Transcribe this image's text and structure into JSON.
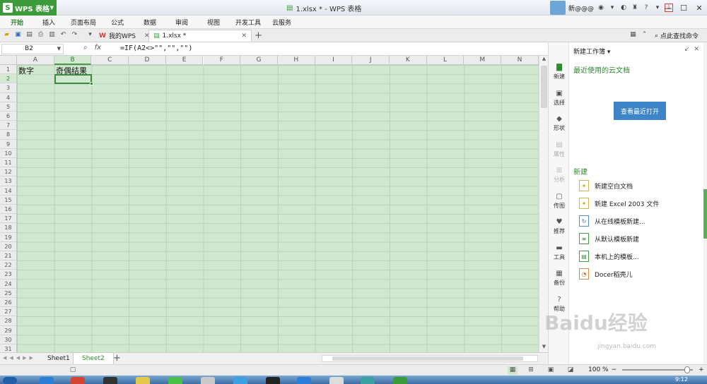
{
  "app": {
    "brand": "WPS 表格",
    "logo_letter": "S",
    "doc_title": "1.xlsx * - WPS 表格",
    "user_name": "新@@@"
  },
  "menu": [
    "开始",
    "插入",
    "页面布局",
    "公式",
    "数据",
    "审阅",
    "视图",
    "开发工具",
    "云服务"
  ],
  "tabs": [
    {
      "label": "我的WPS"
    },
    {
      "label": "1.xlsx *"
    }
  ],
  "command_search": "点此查找命令",
  "formula_bar": {
    "name_box": "B2",
    "formula": "=IF(A2<>\"\",\"\",\"\")",
    "fx_label": "fx"
  },
  "grid": {
    "columns": [
      "A",
      "B",
      "C",
      "D",
      "E",
      "F",
      "G",
      "H",
      "I",
      "J",
      "K",
      "L",
      "M",
      "N"
    ],
    "rows": [
      "1",
      "2",
      "3",
      "4",
      "5",
      "6",
      "7",
      "8",
      "9",
      "10",
      "11",
      "12",
      "13",
      "14",
      "15",
      "16",
      "17",
      "18",
      "19",
      "20",
      "21",
      "22",
      "23",
      "24",
      "25",
      "26",
      "27",
      "28",
      "29",
      "30",
      "31"
    ],
    "cells": {
      "A1": "数字",
      "B1": "奇偶结果"
    },
    "selected": "B2"
  },
  "sheets": [
    "Sheet1",
    "Sheet2"
  ],
  "active_sheet": "Sheet2",
  "status": {
    "zoom": "100 %"
  },
  "side_strip": [
    {
      "label": "新建",
      "icon": "new-doc-icon",
      "glyph": "▇",
      "state": "active"
    },
    {
      "label": "选择",
      "icon": "select-icon",
      "glyph": "▣",
      "state": "normal"
    },
    {
      "label": "形状",
      "icon": "shape-icon",
      "glyph": "◆",
      "state": "normal"
    },
    {
      "label": "属性",
      "icon": "property-icon",
      "glyph": "▤",
      "state": "disabled"
    },
    {
      "label": "分析",
      "icon": "analysis-icon",
      "glyph": "⊞",
      "state": "disabled"
    },
    {
      "label": "传图",
      "icon": "upload-image-icon",
      "glyph": "▢",
      "state": "normal"
    },
    {
      "label": "推荐",
      "icon": "recommend-icon",
      "glyph": "♥",
      "state": "normal"
    },
    {
      "label": "工具",
      "icon": "toolbox-icon",
      "glyph": "▬",
      "state": "normal"
    },
    {
      "label": "备份",
      "icon": "backup-icon",
      "glyph": "▦",
      "state": "normal"
    },
    {
      "label": "帮助",
      "icon": "help-icon",
      "glyph": "?",
      "state": "normal"
    }
  ],
  "task_pane": {
    "header": "新建工作簿",
    "recent_title": "最近使用的云文档",
    "recent_button": "查看最近打开",
    "new_title": "新建",
    "new_items": [
      {
        "label": "新建空白文档",
        "icon": "blank-doc-icon"
      },
      {
        "label": "新建 Excel 2003 文件",
        "icon": "excel2003-icon"
      },
      {
        "label": "从在线模板新建...",
        "icon": "online-template-icon"
      },
      {
        "label": "从默认模板新建",
        "icon": "default-template-icon"
      },
      {
        "label": "本机上的模板...",
        "icon": "local-template-icon"
      },
      {
        "label": "Docer稻壳儿",
        "icon": "docer-icon"
      }
    ]
  },
  "taskbar": {
    "time": "9:12"
  },
  "watermark": {
    "text": "Baidu经验",
    "url": "jingyan.baidu.com"
  },
  "colors": {
    "brand_green": "#3c9a3a",
    "grid_fill": "#cfe8cf",
    "accent_blue": "#3d85c6"
  }
}
